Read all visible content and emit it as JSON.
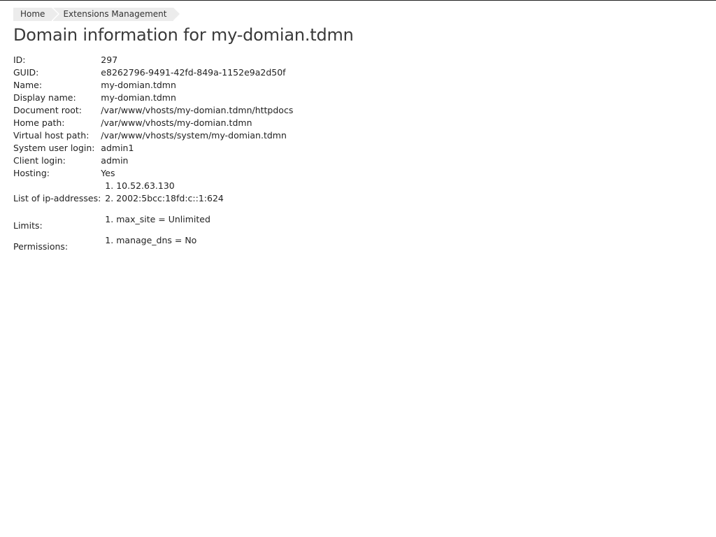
{
  "breadcrumb": [
    "Home",
    "Extensions Management"
  ],
  "title": "Domain information for my-domian.tdmn",
  "fields": [
    {
      "label": "ID:",
      "value": "297"
    },
    {
      "label": "GUID:",
      "value": "e8262796-9491-42fd-849a-1152e9a2d50f"
    },
    {
      "label": "Name:",
      "value": "my-domian.tdmn"
    },
    {
      "label": "Display name:",
      "value": "my-domian.tdmn"
    },
    {
      "label": "Document root:",
      "value": "/var/www/vhosts/my-domian.tdmn/httpdocs"
    },
    {
      "label": "Home path:",
      "value": "/var/www/vhosts/my-domian.tdmn"
    },
    {
      "label": "Virtual host path:",
      "value": "/var/www/vhosts/system/my-domian.tdmn"
    },
    {
      "label": "System user login:",
      "value": "admin1"
    },
    {
      "label": "Client login:",
      "value": "admin"
    },
    {
      "label": "Hosting:",
      "value": "Yes"
    }
  ],
  "lists": [
    {
      "label": "List of ip-addresses:",
      "items": [
        "10.52.63.130",
        "2002:5bcc:18fd:c::1:624"
      ]
    },
    {
      "label": "Limits:",
      "items": [
        "max_site = Unlimited"
      ]
    },
    {
      "label": "Permissions:",
      "items": [
        "manage_dns = No"
      ]
    }
  ]
}
